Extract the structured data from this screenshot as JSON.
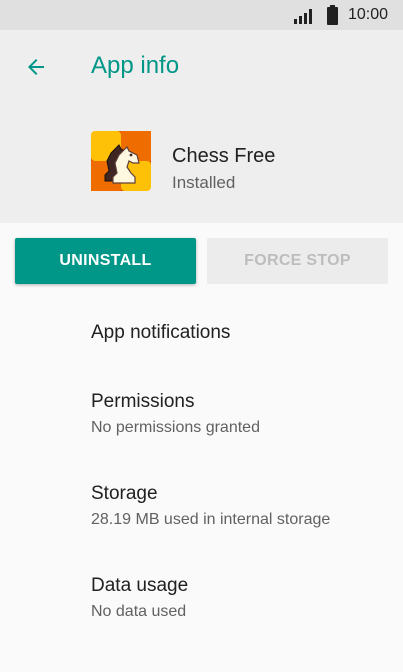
{
  "status_bar": {
    "time": "10:00",
    "icons": [
      "signal-icon",
      "battery-icon"
    ]
  },
  "header": {
    "back_icon": "arrow-left-icon",
    "title": "App info",
    "app": {
      "icon": "chess-knight-app-icon",
      "name": "Chess Free",
      "status": "Installed"
    }
  },
  "buttons": {
    "uninstall": "UNINSTALL",
    "force_stop": "FORCE STOP"
  },
  "settings": {
    "items": [
      {
        "title": "App notifications",
        "subtitle": ""
      },
      {
        "title": "Permissions",
        "subtitle": "No permissions granted"
      },
      {
        "title": "Storage",
        "subtitle": "28.19 MB used in internal storage"
      },
      {
        "title": "Data usage",
        "subtitle": "No data used"
      }
    ]
  },
  "colors": {
    "accent": "#009688",
    "header_bg": "#eeeeee",
    "status_bar_bg": "#e0e0e0",
    "disabled_button_bg": "#ececec",
    "disabled_text": "#bdbdbd"
  }
}
